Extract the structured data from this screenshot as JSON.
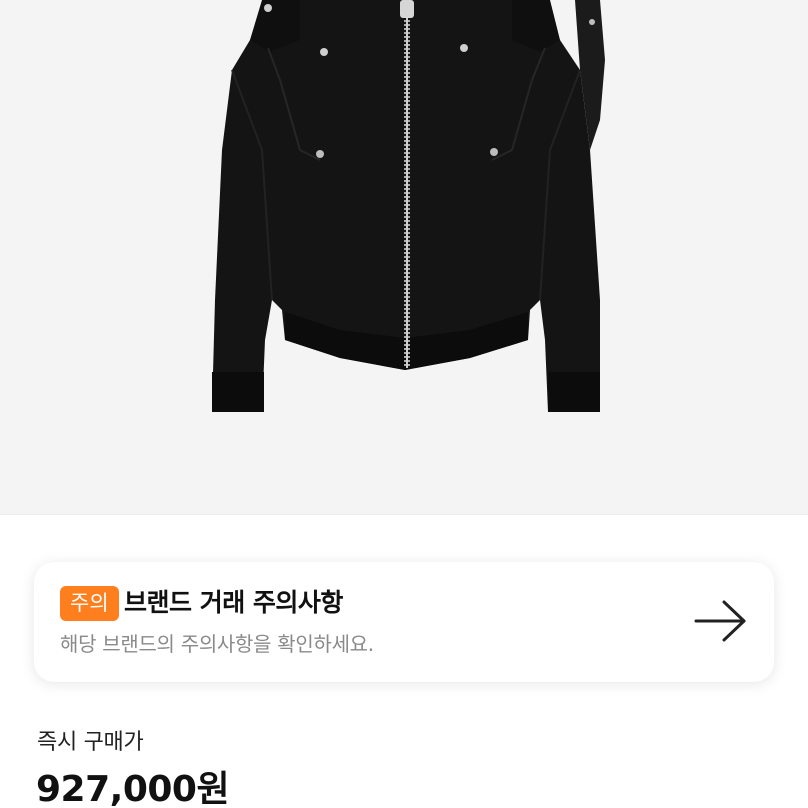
{
  "product": {
    "image_icon": "black-bomber-jacket"
  },
  "notice": {
    "badge": "주의",
    "title": "브랜드 거래 주의사항",
    "description": "해당 브랜드의 주의사항을 확인하세요.",
    "arrow_icon": "arrow-right-icon",
    "badge_color": "#ff7e1d"
  },
  "purchase": {
    "label": "즉시 구매가",
    "price": "927,000원"
  }
}
